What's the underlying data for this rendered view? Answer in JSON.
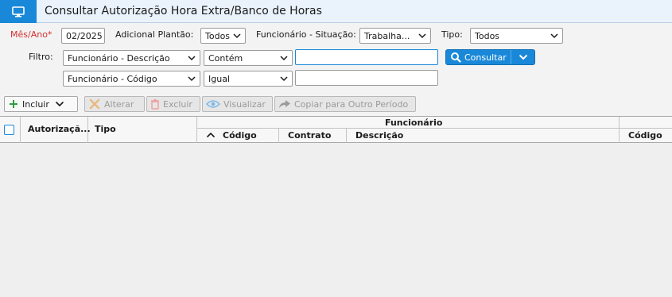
{
  "window": {
    "title": "Consultar Autorização Hora Extra/Banco de Horas",
    "icon": "monitor-icon"
  },
  "filters": {
    "mes_ano_label": "Mês/Ano*",
    "mes_ano_value": "02/2025",
    "adicional_label": "Adicional Plantão:",
    "adicional_value": "Todos",
    "func_situacao_label": "Funcionário - Situação:",
    "func_situacao_value": "Trabalha...",
    "tipo_label": "Tipo:",
    "tipo_value": "Todos",
    "filtro_label": "Filtro:",
    "row1_field": "Funcionário - Descrição",
    "row1_operator": "Contém",
    "row1_value": "",
    "row2_field": "Funcionário - Código",
    "row2_operator": "Igual",
    "row2_value": ""
  },
  "actions": {
    "consultar": "Consultar",
    "incluir": "Incluir",
    "alterar": "Alterar",
    "excluir": "Excluir",
    "visualizar": "Visualizar",
    "copiar": "Copiar para Outro Período"
  },
  "grid": {
    "col_autorizacao": "Autorizaçã...",
    "col_tipo": "Tipo",
    "group_funcionario": "Funcionário",
    "col_codigo": "Código",
    "col_contrato": "Contrato",
    "col_descricao": "Descrição",
    "col_codigo2": "Código"
  },
  "colors": {
    "accent": "#1a88d8",
    "required": "#d32f2f"
  }
}
